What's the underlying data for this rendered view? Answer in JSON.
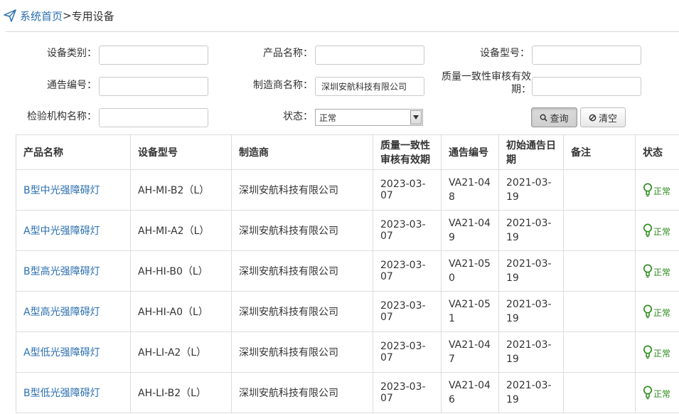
{
  "breadcrumb": {
    "home": "系统首页",
    "separator": ">",
    "current": "专用设备"
  },
  "form": {
    "device_category_label": "设备类别：",
    "product_name_label": "产品名称：",
    "device_model_label": "设备型号：",
    "notice_no_label": "通告编号：",
    "manufacturer_label": "制造商名称：",
    "manufacturer_value": "深圳安航科技有限公司",
    "validity_label_line1": "质量一致性审核有效",
    "validity_label_line2": "期：",
    "inspection_org_label": "检验机构名称：",
    "status_label": "状态：",
    "status_value": "正常",
    "search_button": "查询",
    "clear_button": "清空"
  },
  "table": {
    "headers": {
      "product_name": "产品名称",
      "device_model": "设备型号",
      "manufacturer": "制造商",
      "validity": "质量一致性审核有效期",
      "notice_no": "通告编号",
      "initial_date": "初始通告日期",
      "remark": "备注",
      "status": "状态"
    },
    "rows": [
      {
        "product_name": "B型中光强障碍灯",
        "device_model": "AH-MI-B2（L）",
        "manufacturer": "深圳安航科技有限公司",
        "validity": "2023-03-07",
        "notice_no": "VA21-048",
        "initial_date": "2021-03-19",
        "remark": "",
        "status": "正常"
      },
      {
        "product_name": "A型中光强障碍灯",
        "device_model": "AH-MI-A2（L）",
        "manufacturer": "深圳安航科技有限公司",
        "validity": "2023-03-07",
        "notice_no": "VA21-049",
        "initial_date": "2021-03-19",
        "remark": "",
        "status": "正常"
      },
      {
        "product_name": "B型高光强障碍灯",
        "device_model": "AH-HI-B0（L）",
        "manufacturer": "深圳安航科技有限公司",
        "validity": "2023-03-07",
        "notice_no": "VA21-050",
        "initial_date": "2021-03-19",
        "remark": "",
        "status": "正常"
      },
      {
        "product_name": "A型高光强障碍灯",
        "device_model": "AH-HI-A0（L）",
        "manufacturer": "深圳安航科技有限公司",
        "validity": "2023-03-07",
        "notice_no": "VA21-051",
        "initial_date": "2021-03-19",
        "remark": "",
        "status": "正常"
      },
      {
        "product_name": "A型低光强障碍灯",
        "device_model": "AH-LI-A2（L）",
        "manufacturer": "深圳安航科技有限公司",
        "validity": "2023-03-07",
        "notice_no": "VA21-047",
        "initial_date": "2021-03-19",
        "remark": "",
        "status": "正常"
      },
      {
        "product_name": "B型低光强障碍灯",
        "device_model": "AH-LI-B2（L）",
        "manufacturer": "深圳安航科技有限公司",
        "validity": "2023-03-07",
        "notice_no": "VA21-046",
        "initial_date": "2021-03-19",
        "remark": "",
        "status": "正常"
      }
    ]
  },
  "colors": {
    "link": "#2a6fb0",
    "status_ok": "#2e8b1e"
  },
  "icons": {
    "breadcrumb": "paper-plane-icon",
    "search": "search-icon",
    "clear": "ban-icon",
    "status": "bulb-icon"
  }
}
